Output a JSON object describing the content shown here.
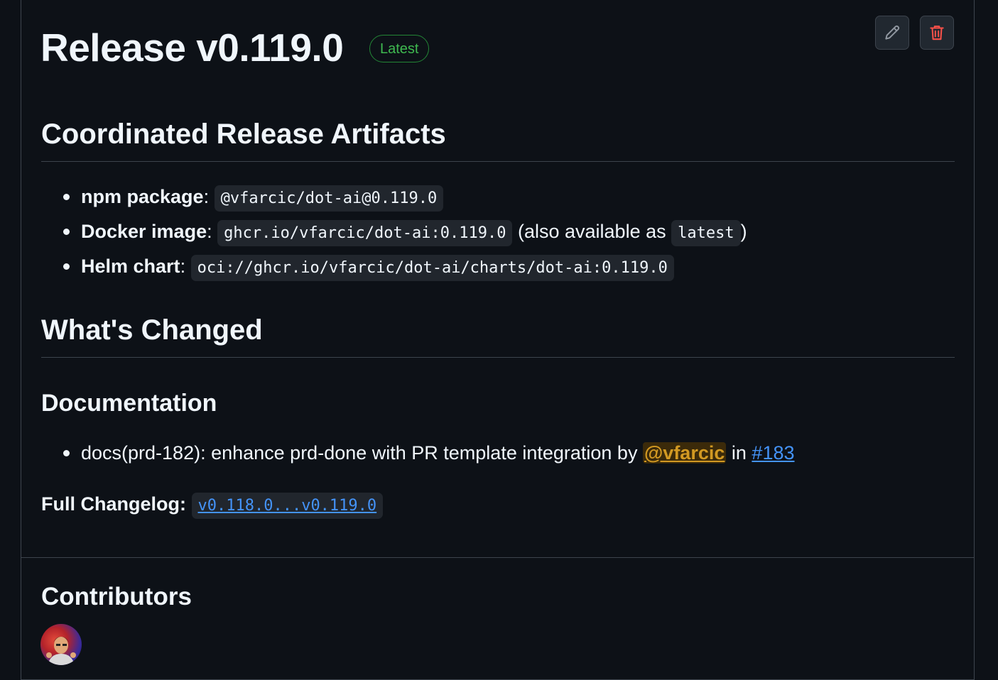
{
  "release": {
    "title": "Release v0.119.0",
    "badge": "Latest",
    "edit_label": "Edit",
    "delete_label": "Delete"
  },
  "artifacts": {
    "heading": "Coordinated Release Artifacts",
    "items": [
      {
        "label": "npm package",
        "code": "@vfarcic/dot-ai@0.119.0"
      },
      {
        "label": "Docker image",
        "code": "ghcr.io/vfarcic/dot-ai:0.119.0",
        "suffix_pre": "(also available as",
        "suffix_code": "latest",
        "suffix_post": ")"
      },
      {
        "label": "Helm chart",
        "code": "oci://ghcr.io/vfarcic/dot-ai/charts/dot-ai:0.119.0"
      }
    ]
  },
  "changed": {
    "heading": "What's Changed",
    "subheading": "Documentation",
    "items": [
      {
        "text": "docs(prd-182): enhance prd-done with PR template integration by",
        "mention": "@vfarcic",
        "in": "in",
        "pr": "#183"
      }
    ]
  },
  "changelog": {
    "label": "Full Changelog",
    "link": "v0.118.0...v0.119.0"
  },
  "contributors": {
    "heading": "Contributors",
    "avatar_alt": "vfarcic"
  },
  "colors": {
    "background": "#0d1117",
    "badge_green": "#3fb950",
    "link_blue": "#4493f8",
    "mention_gold": "#d29922",
    "delete_red": "#f85149"
  }
}
